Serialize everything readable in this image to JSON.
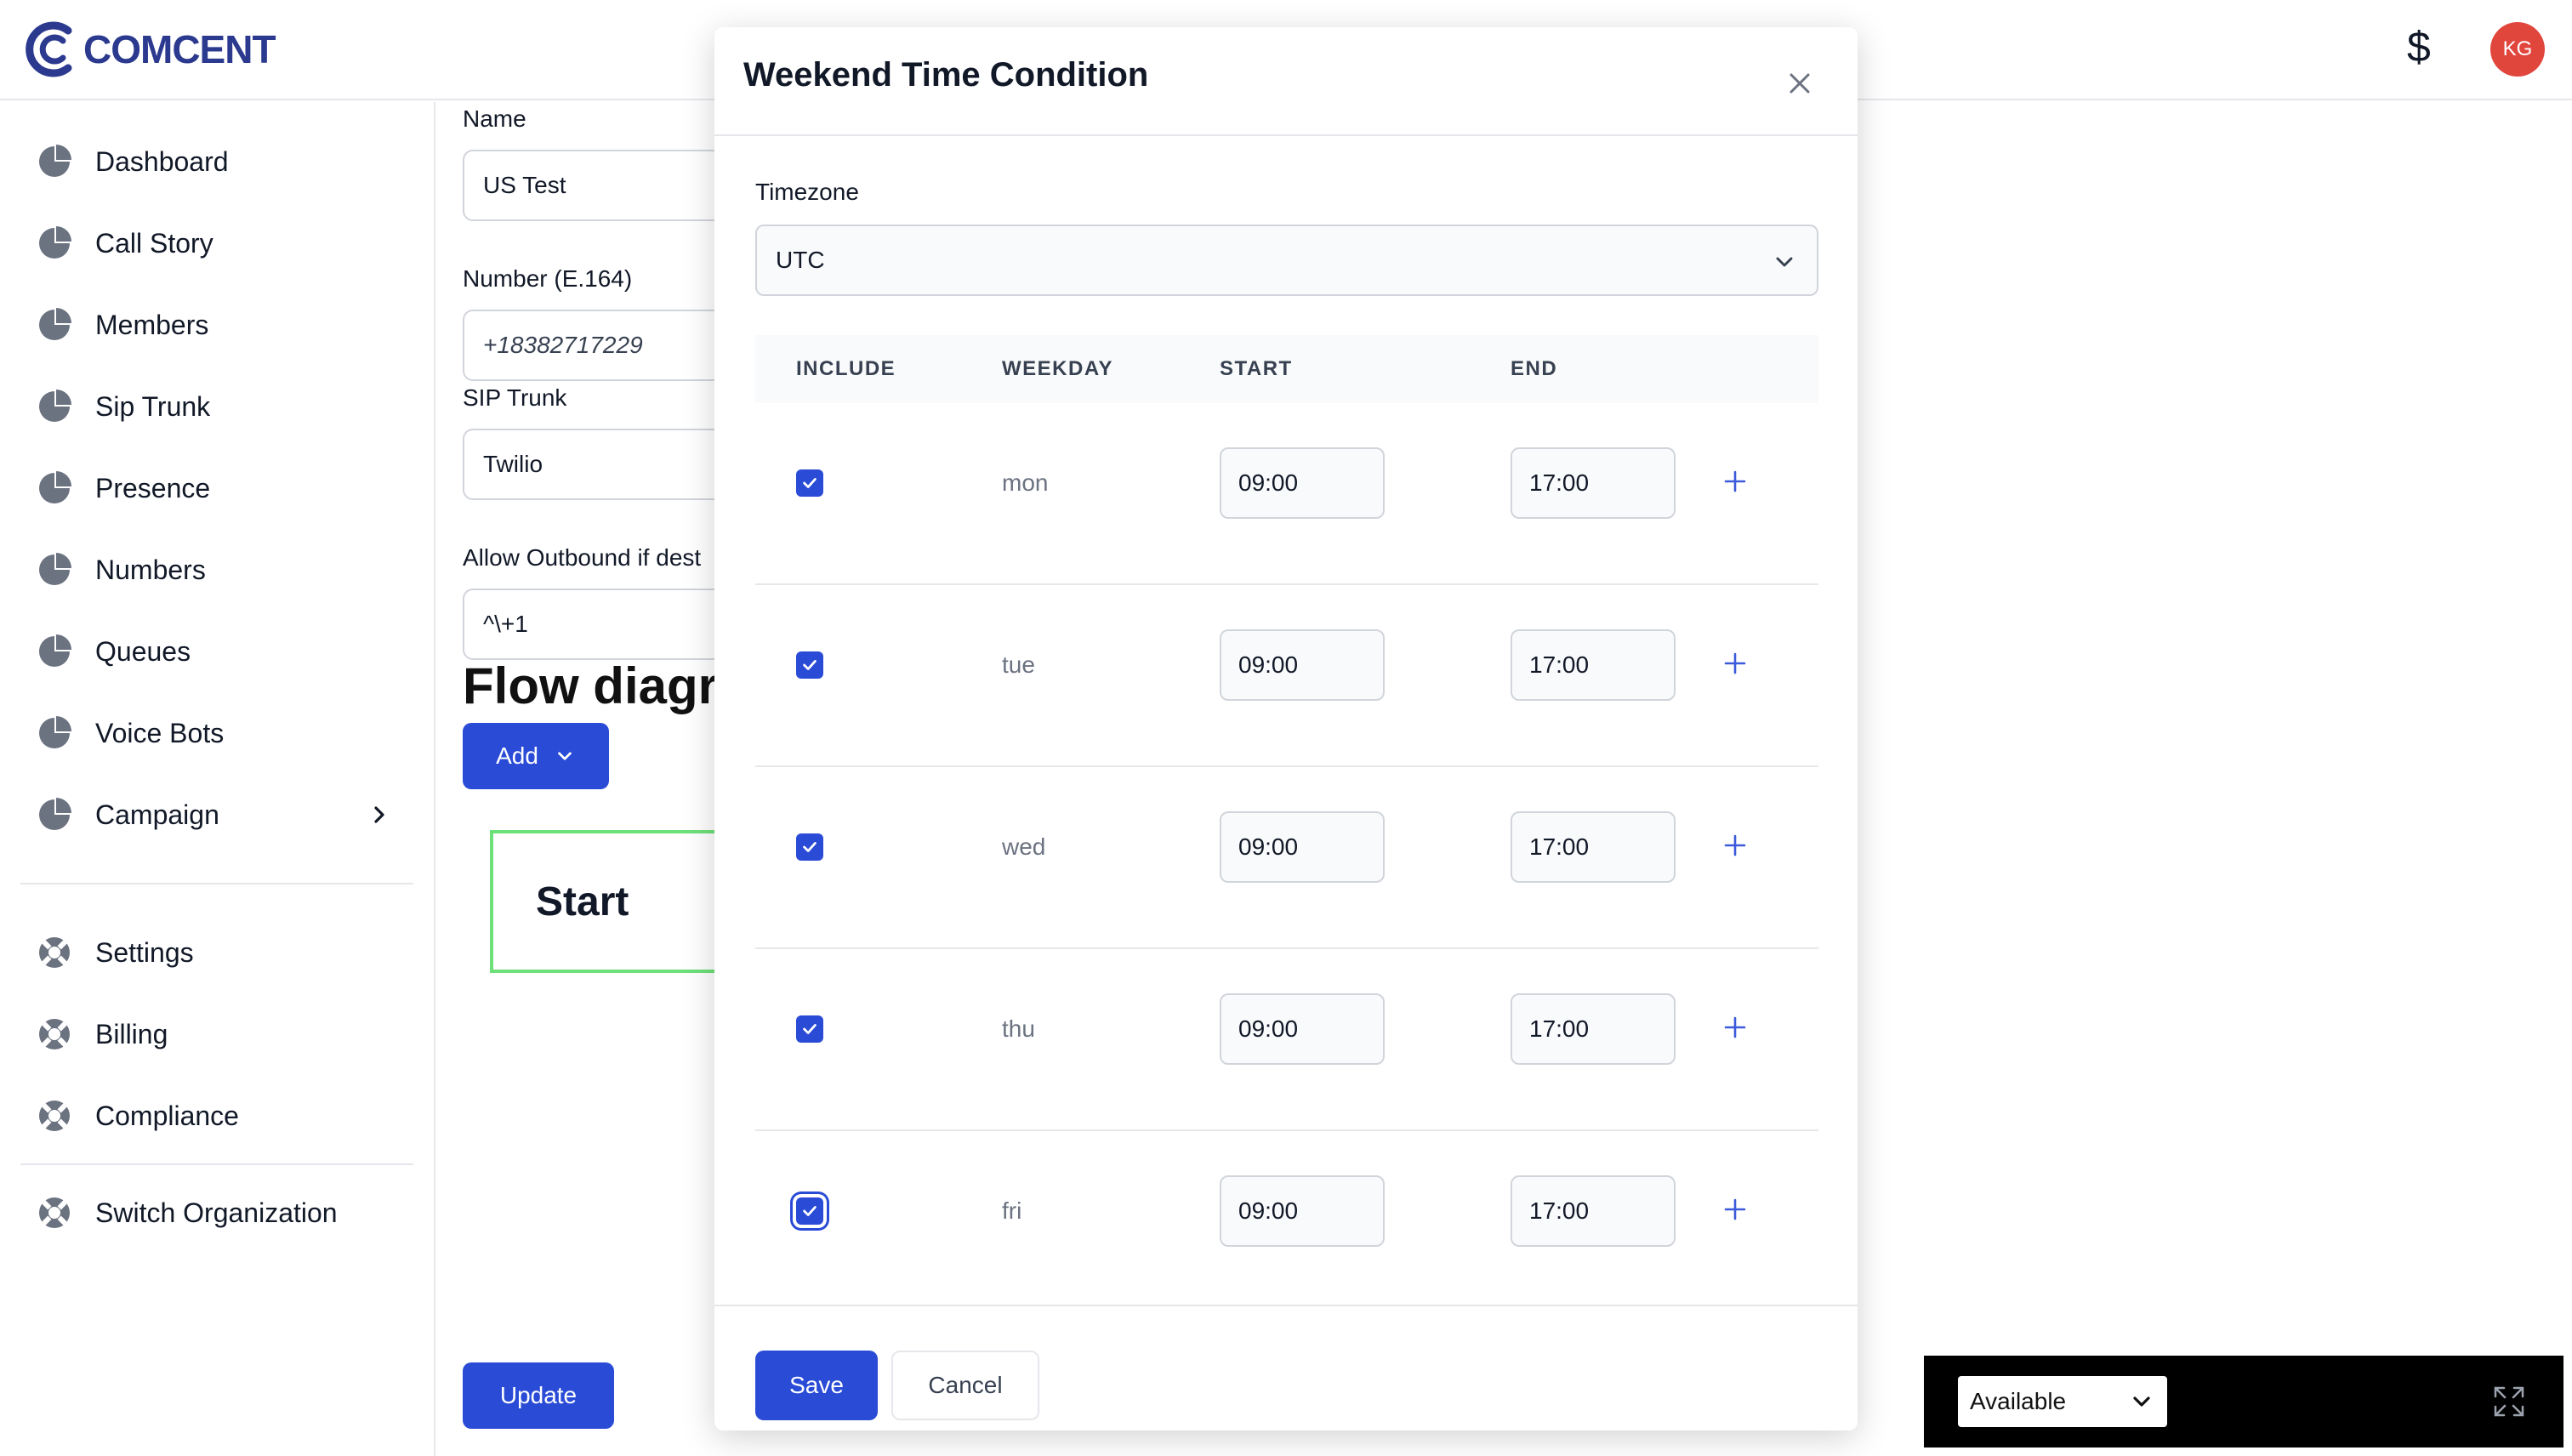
{
  "app": {
    "logo_text": "COMCENT"
  },
  "header": {
    "currency_symbol": "$",
    "avatar_initials": "KG"
  },
  "sidebar": {
    "items": [
      {
        "label": "Dashboard"
      },
      {
        "label": "Call Story"
      },
      {
        "label": "Members"
      },
      {
        "label": "Sip Trunk"
      },
      {
        "label": "Presence"
      },
      {
        "label": "Numbers"
      },
      {
        "label": "Queues"
      },
      {
        "label": "Voice Bots"
      },
      {
        "label": "Campaign"
      }
    ],
    "secondary": [
      {
        "label": "Settings"
      },
      {
        "label": "Billing"
      },
      {
        "label": "Compliance"
      }
    ],
    "switch_org": "Switch Organization"
  },
  "form": {
    "name_label": "Name",
    "name_value": "US Test",
    "number_label": "Number (E.164)",
    "number_value": "+18382717229",
    "sip_label": "SIP Trunk",
    "sip_value": "Twilio",
    "outbound_label": "Allow Outbound if dest",
    "outbound_value": "^\\+1",
    "flow_title": "Flow diagra",
    "add_label": "Add",
    "start_label": "Start",
    "update_label": "Update"
  },
  "modal": {
    "title": "Weekend Time Condition",
    "timezone_label": "Timezone",
    "timezone_value": "UTC",
    "columns": {
      "include": "INCLUDE",
      "weekday": "WEEKDAY",
      "start": "START",
      "end": "END"
    },
    "rows": [
      {
        "include": true,
        "weekday": "mon",
        "start": "09:00",
        "end": "17:00"
      },
      {
        "include": true,
        "weekday": "tue",
        "start": "09:00",
        "end": "17:00"
      },
      {
        "include": true,
        "weekday": "wed",
        "start": "09:00",
        "end": "17:00"
      },
      {
        "include": true,
        "weekday": "thu",
        "start": "09:00",
        "end": "17:00"
      },
      {
        "include": true,
        "weekday": "fri",
        "start": "09:00",
        "end": "17:00"
      }
    ],
    "save_label": "Save",
    "cancel_label": "Cancel"
  },
  "status": {
    "value": "Available"
  },
  "colors": {
    "primary": "#2a4bd6",
    "brand": "#2b3a8f",
    "avatar": "#e1463d",
    "start_border": "#6ee07a"
  },
  "icons": {
    "nav": "pie-chart-icon",
    "secondary": "lifebuoy-icon",
    "close": "close-icon",
    "chevron": "chevron-down-icon",
    "plus": "plus-icon",
    "expand": "expand-icon"
  }
}
